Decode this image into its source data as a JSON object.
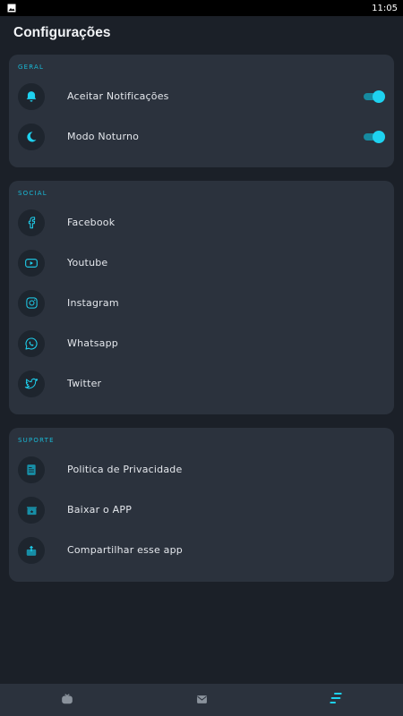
{
  "status_bar": {
    "time": "11:05"
  },
  "header": {
    "title": "Configurações"
  },
  "sections": {
    "geral": {
      "label": "GERAL",
      "items": [
        {
          "label": "Aceitar Notificações",
          "icon": "bell-icon",
          "toggle": true
        },
        {
          "label": "Modo Noturno",
          "icon": "moon-icon",
          "toggle": true
        }
      ]
    },
    "social": {
      "label": "SOCIAL",
      "items": [
        {
          "label": "Facebook",
          "icon": "facebook-icon"
        },
        {
          "label": "Youtube",
          "icon": "youtube-icon"
        },
        {
          "label": "Instagram",
          "icon": "instagram-icon"
        },
        {
          "label": "Whatsapp",
          "icon": "whatsapp-icon"
        },
        {
          "label": "Twitter",
          "icon": "twitter-icon"
        }
      ]
    },
    "suporte": {
      "label": "SUPORTE",
      "items": [
        {
          "label": "Politica de Privacidade",
          "icon": "document-icon"
        },
        {
          "label": "Baixar o APP",
          "icon": "store-icon"
        },
        {
          "label": "Compartilhar esse app",
          "icon": "share-icon"
        }
      ]
    }
  },
  "bottom_nav": {
    "items": [
      {
        "icon": "tv-icon",
        "active": false
      },
      {
        "icon": "mail-icon",
        "active": false
      },
      {
        "icon": "settings-menu-icon",
        "active": true
      }
    ]
  },
  "colors": {
    "background": "#1b2028",
    "card": "#2b323d",
    "accent": "#1ed2f0",
    "icon_bg": "#1e252e"
  }
}
